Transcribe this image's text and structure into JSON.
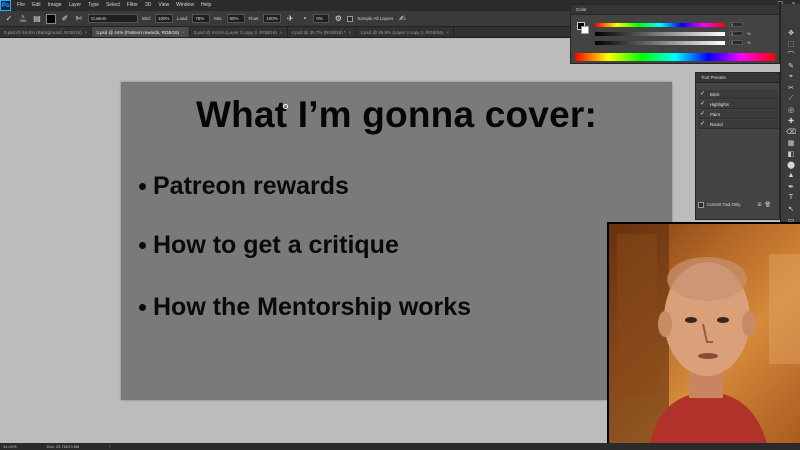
{
  "app": {
    "logo": "Ps"
  },
  "menu": [
    "File",
    "Edit",
    "Image",
    "Layer",
    "Type",
    "Select",
    "Filter",
    "3D",
    "View",
    "Window",
    "Help"
  ],
  "window_controls": {
    "minimize": "—",
    "maximize": "❐",
    "close": "✕"
  },
  "options_bar": {
    "brush_size": "300",
    "mode_value": "Custom",
    "width_label": "Wid:",
    "width_value": "100%",
    "load_label": "Load:",
    "load_value": "75%",
    "mix_label": "Mix:",
    "mix_value": "90%",
    "flow_label": "Flow:",
    "flow_value": "100%",
    "smoothing_value": "0%",
    "sample_label": "Sample All Layers"
  },
  "tabs": [
    {
      "label": "5.psd @ 46.8% (Background, RGB/16)",
      "active": false
    },
    {
      "label": "3.psd @ 44% (Patreon rewards, RGB/16)",
      "active": true
    },
    {
      "label": "3.psd @ 44.6% (Layer 3 copy 2, RGB/16)",
      "active": false
    },
    {
      "label": "4.psd @ 35.7% (RGB/16) *",
      "active": false
    },
    {
      "label": "3.psd @ 45.8% (Layer 3 copy 2, RGB/16)",
      "active": false
    }
  ],
  "tab_close_glyph": "×",
  "slide": {
    "title": "What I’m gonna cover:",
    "bullets": [
      "Patreon rewards",
      "How to get a critique",
      "How the Mentorship works"
    ]
  },
  "color_panel": {
    "title": "Color",
    "values": [
      "0",
      "0",
      "0"
    ],
    "units": [
      "",
      "%",
      "%"
    ]
  },
  "tool_presets_panel": {
    "title": "Tool Presets",
    "presets": [
      "Brick",
      "Highlights",
      "Paint",
      "Round"
    ],
    "current_tool_only": "Current Tool Only"
  },
  "status_bar": {
    "zoom": "44.04%",
    "doc": "Doc: 23.7M/23.6M",
    "arrow": "›"
  },
  "tools": [
    "✥",
    "⬚",
    "⌒",
    "✎",
    "⌖",
    "✂",
    "⟋",
    "◎",
    "✚",
    "⌫",
    "▦",
    "◧",
    "⬤",
    "▲",
    "✒",
    "T",
    "↖",
    "▭",
    "✋",
    "🔍"
  ]
}
